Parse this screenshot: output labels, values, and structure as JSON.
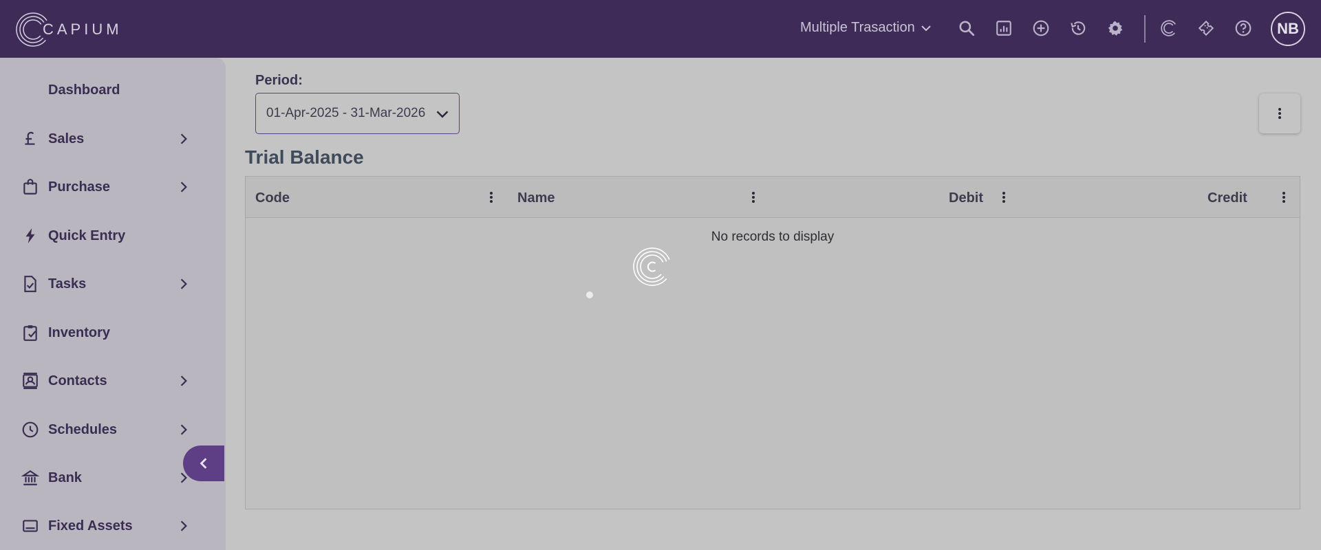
{
  "app": {
    "logo_text": "CAPIUM",
    "brand_color": "#3e2b58",
    "accent_color": "#5e3f86"
  },
  "header": {
    "transaction_select": "Multiple Trasaction",
    "icons": [
      "search-icon",
      "report-icon",
      "add-circle-icon",
      "history-icon",
      "settings-icon",
      "capium-c-icon",
      "ticket-icon",
      "help-icon"
    ],
    "avatar_initials": "NB"
  },
  "sidebar": {
    "items": [
      {
        "label": "Dashboard",
        "icon": "dashboard-icon",
        "has_children": false
      },
      {
        "label": "Sales",
        "icon": "pound-icon",
        "has_children": true
      },
      {
        "label": "Purchase",
        "icon": "shopping-bag-icon",
        "has_children": true
      },
      {
        "label": "Quick Entry",
        "icon": "bolt-icon",
        "has_children": false
      },
      {
        "label": "Tasks",
        "icon": "task-icon",
        "has_children": true
      },
      {
        "label": "Inventory",
        "icon": "clipboard-check-icon",
        "has_children": false
      },
      {
        "label": "Contacts",
        "icon": "contact-card-icon",
        "has_children": true
      },
      {
        "label": "Schedules",
        "icon": "clock-icon",
        "has_children": true
      },
      {
        "label": "Bank",
        "icon": "bank-icon",
        "has_children": true
      },
      {
        "label": "Fixed Assets",
        "icon": "laptop-icon",
        "has_children": true
      }
    ]
  },
  "filters": {
    "period_label": "Period:",
    "period_value": "01-Apr-2025 - 31-Mar-2026"
  },
  "page": {
    "title": "Trial Balance"
  },
  "table": {
    "columns": [
      "Code",
      "Name",
      "Debit",
      "Credit"
    ],
    "empty_message": "No records to display"
  }
}
